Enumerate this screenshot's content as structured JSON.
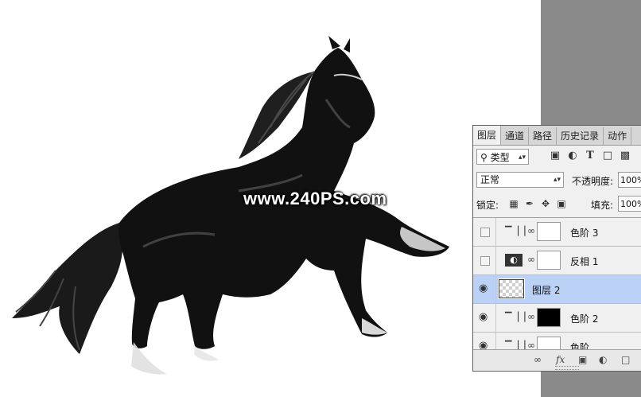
{
  "watermark": "www.240PS.com",
  "panel": {
    "tabs": [
      "图层",
      "通道",
      "路径",
      "历史记录",
      "动作"
    ],
    "filter": {
      "label": "类型",
      "icon": "search-icon"
    },
    "blend_mode": "正常",
    "opacity_label": "不透明度:",
    "opacity_value": "100%",
    "lock_label": "锁定:",
    "fill_label": "填充:",
    "fill_value": "100%",
    "layers": [
      {
        "name": "色阶 3",
        "visible": false,
        "type": "levels"
      },
      {
        "name": "反相 1",
        "visible": false,
        "type": "invert"
      },
      {
        "name": "图层 2",
        "visible": true,
        "type": "pixel",
        "selected": true
      },
      {
        "name": "色阶 2",
        "visible": true,
        "type": "levels"
      },
      {
        "name": "色阶",
        "visible": true,
        "type": "levels"
      }
    ]
  },
  "colors": {
    "selected_row": "#bcd1f6",
    "workspace_gray": "#8a8a8a",
    "panel_bg": "#f0f0f0"
  }
}
